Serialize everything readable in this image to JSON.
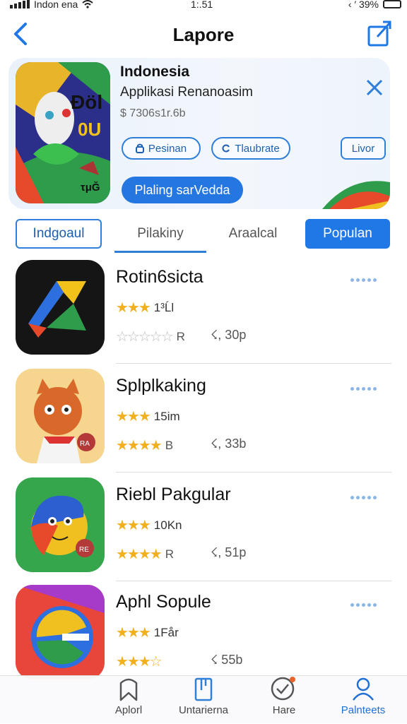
{
  "status": {
    "carrier": "Indon ena",
    "time": "1:.51",
    "battery": "‹ ′ 39%"
  },
  "nav": {
    "title": "Lapore"
  },
  "featured": {
    "name": "Indonesia",
    "subtitle": "Applikasi Renanoasim",
    "meta": "$ 7306s1r.6b",
    "icon_text_top": "Đöl",
    "icon_text_mid": "0U",
    "icon_text_bottom": "τμĞ",
    "chip1": "Pesinan",
    "chip2": "Tlaubrate",
    "chip3": "Livor",
    "cta": "Plaling sarVedda"
  },
  "tabs": [
    "Indgoaul",
    "Pilakiny",
    "Araalcal",
    "Populan"
  ],
  "apps": [
    {
      "name": "Rotin6sicta",
      "rating_text": "1³Ĺl",
      "rating2_text": "R",
      "size": "☇, 30p",
      "stars1": 3,
      "stars2": 0
    },
    {
      "name": "Splplkaking",
      "rating_text": "15im",
      "rating2_text": "B",
      "size": "☇, 33b",
      "stars1": 3,
      "stars2": 4,
      "badge": "RA"
    },
    {
      "name": "Riebl Pakgular",
      "rating_text": "10Kn",
      "rating2_text": "R",
      "size": "☇, 51p",
      "stars1": 3,
      "stars2": 4,
      "badge": "RE"
    },
    {
      "name": "Aphl Sopule",
      "rating_text": "1Får",
      "rating2_text": "",
      "size": "☇ 55b",
      "stars1": 3,
      "stars2": 3
    }
  ],
  "tabbar": [
    {
      "label": "Aplorl",
      "icon": "bookmark-icon"
    },
    {
      "label": "Untarierna",
      "icon": "phone-icon"
    },
    {
      "label": "Hare",
      "icon": "check-circle-icon"
    },
    {
      "label": "Palnteets",
      "icon": "person-icon"
    }
  ],
  "colors": {
    "accent": "#1f78e6",
    "star": "#f2b01e"
  }
}
